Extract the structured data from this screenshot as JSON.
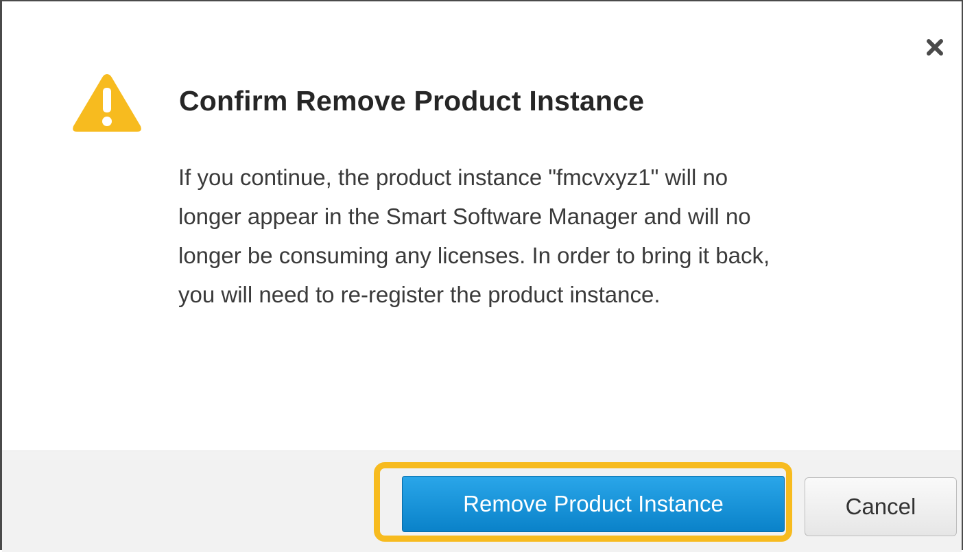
{
  "dialog": {
    "title": "Confirm Remove Product Instance",
    "message_lines": [
      "If you continue, the product instance \"fmcvxyz1\" will no",
      "longer appear in the Smart Software Manager and will no",
      "longer be consuming any licenses. In order to bring it back,",
      "you will need to re-register the product instance."
    ],
    "icons": {
      "warning": "warning-icon",
      "close": "close-icon"
    }
  },
  "buttons": {
    "confirm_label": "Remove Product Instance",
    "cancel_label": "Cancel"
  },
  "colors": {
    "warning": "#f7bb1f",
    "primary_button": "#1a94db",
    "highlight": "#f7bb1f"
  }
}
